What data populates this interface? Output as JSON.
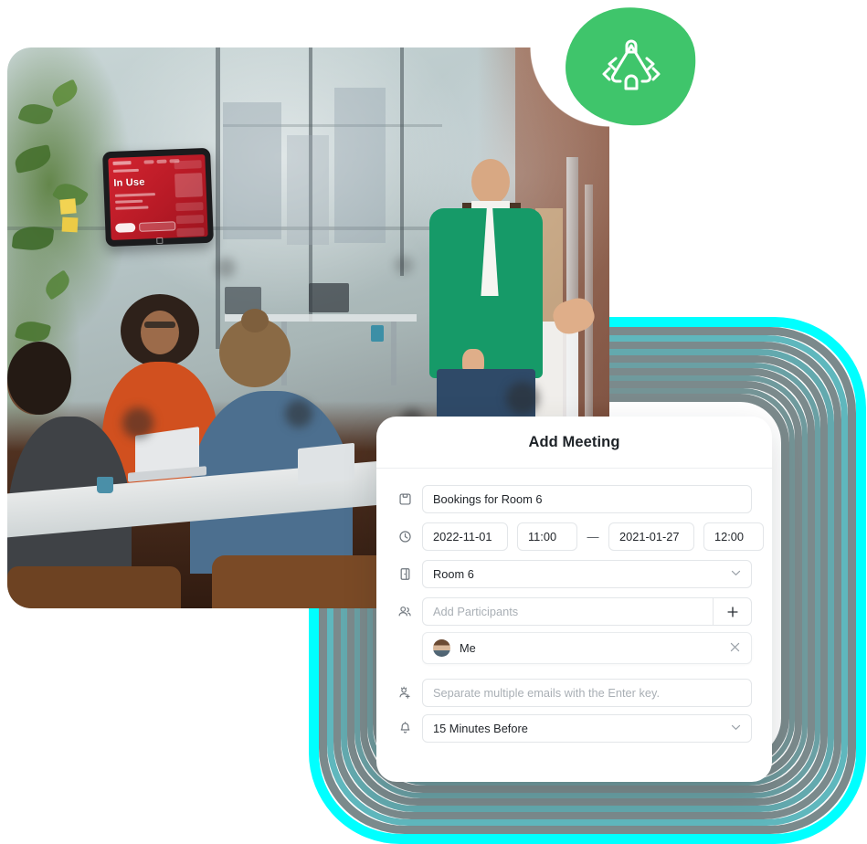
{
  "badge": {
    "icon": "meeting-room-table-icon",
    "color": "#3fc56b"
  },
  "photo": {
    "alt": "Team meeting in a modern office conference room",
    "wall_tablet": {
      "status": "In Use",
      "screen_color": "#c91f2b"
    }
  },
  "decoration": {
    "ring_accent_color": "#00ffff",
    "ring_muted_color": "#7b8a8c"
  },
  "dialog": {
    "title": "Add Meeting",
    "rows": {
      "subject": {
        "icon": "note-icon",
        "value": "Bookings for Room 6"
      },
      "schedule": {
        "icon": "clock-icon",
        "start_date": "2022-11-01",
        "start_time": "11:00",
        "separator": "—",
        "end_date": "2021-01-27",
        "end_time": "12:00"
      },
      "room": {
        "icon": "door-icon",
        "value": "Room 6",
        "chevron": "chevron-down-icon"
      },
      "participants": {
        "icon": "people-icon",
        "placeholder": "Add Participants",
        "value": "",
        "add_label": "+"
      },
      "attendee_chip": {
        "avatar": "user-avatar",
        "name": "Me",
        "remove_label": "✕"
      },
      "emails": {
        "icon": "add-person-icon",
        "placeholder": "Separate multiple emails with the Enter key.",
        "value": ""
      },
      "reminder": {
        "icon": "bell-icon",
        "value": "15 Minutes Before",
        "chevron": "chevron-down-icon"
      }
    }
  }
}
